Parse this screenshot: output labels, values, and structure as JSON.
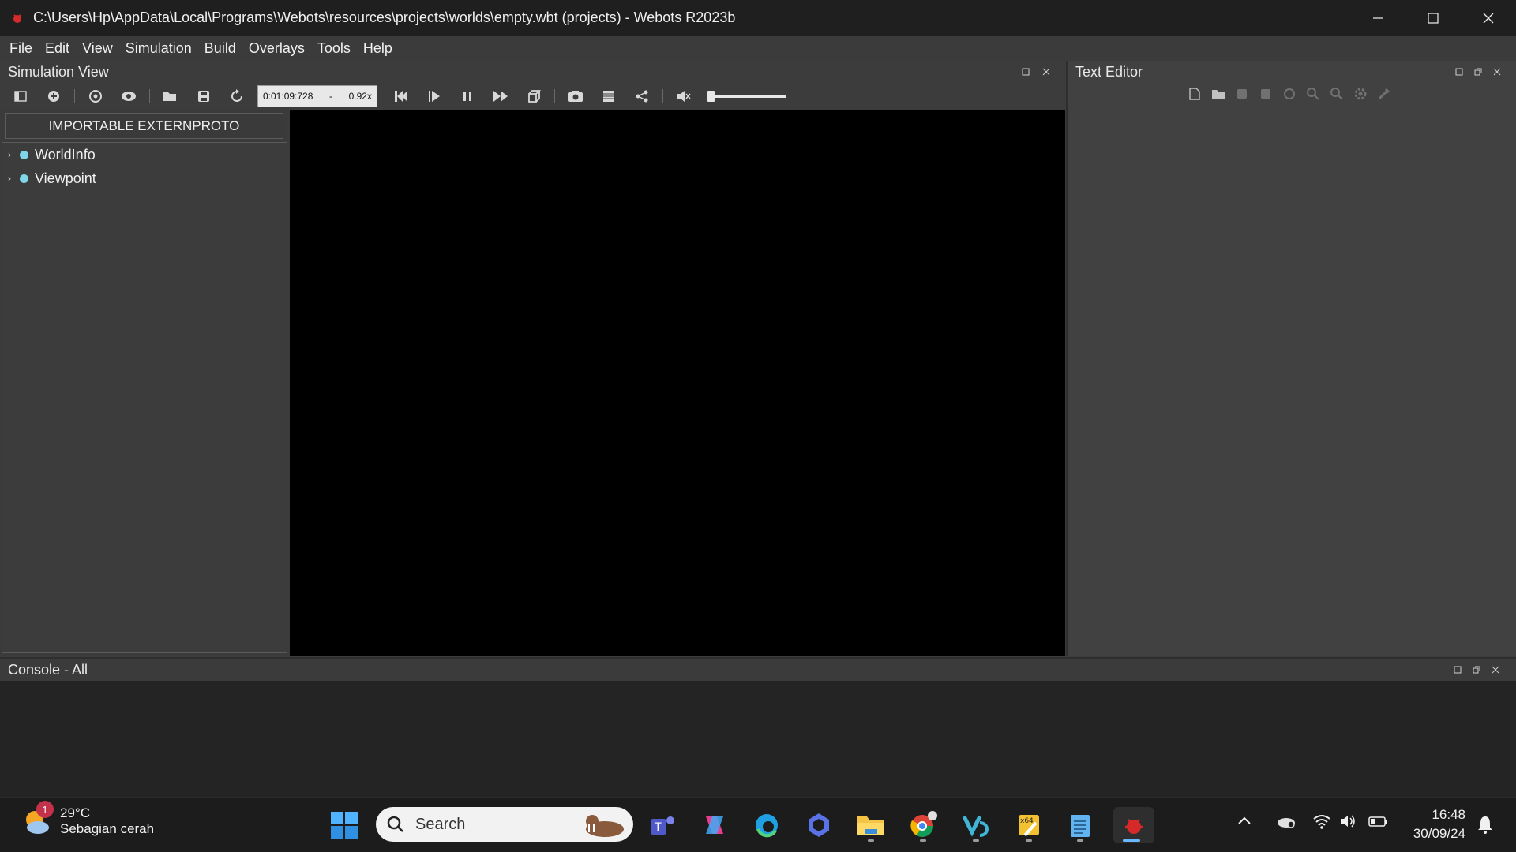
{
  "window": {
    "title": "C:\\Users\\Hp\\AppData\\Local\\Programs\\Webots\\resources\\projects\\worlds\\empty.wbt (projects) - Webots R2023b"
  },
  "menu": [
    "File",
    "Edit",
    "View",
    "Simulation",
    "Build",
    "Overlays",
    "Tools",
    "Help"
  ],
  "simulation_view": {
    "title": "Simulation View",
    "time": "0:01:09:728",
    "speed_sep": "-",
    "speed": "0.92x"
  },
  "scene_tree": {
    "import_button": "IMPORTABLE EXTERNPROTO",
    "items": [
      "WorldInfo",
      "Viewpoint"
    ]
  },
  "text_editor": {
    "title": "Text Editor"
  },
  "console": {
    "title": "Console - All"
  },
  "taskbar": {
    "weather_temp": "29°C",
    "weather_condition": "Sebagian cerah",
    "weather_badge": "1",
    "search_label": "Search",
    "time": "16:48",
    "date": "30/09/24"
  },
  "colors": {
    "accent": "#6ab7ff",
    "tree_dot": "#7fd6e8",
    "badge": "#c4314b"
  }
}
